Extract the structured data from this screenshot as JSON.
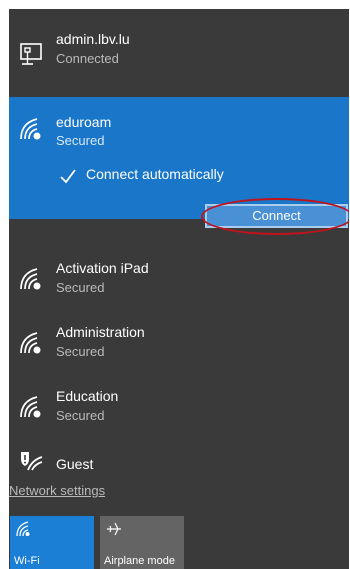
{
  "wired": {
    "name": "admin.lbv.lu",
    "status": "Connected"
  },
  "selected": {
    "name": "eduroam",
    "status": "Secured",
    "auto_label": "Connect automatically",
    "connect_label": "Connect"
  },
  "networks": [
    {
      "name": "Activation iPad",
      "status": "Secured"
    },
    {
      "name": "Administration",
      "status": "Secured"
    },
    {
      "name": "Education",
      "status": "Secured"
    }
  ],
  "guest": {
    "name": "Guest"
  },
  "network_settings": "Network settings",
  "tiles": [
    {
      "label": "Wi-Fi",
      "icon": "wifi-icon"
    },
    {
      "label": "Airplane mode",
      "icon": "airplane-icon"
    }
  ],
  "colors": {
    "panel": "#3a3a3a",
    "selected": "#1976c8",
    "wifi_tile": "#1c7fd6",
    "airplane_tile": "#646464",
    "annotation": "#c0141c"
  }
}
